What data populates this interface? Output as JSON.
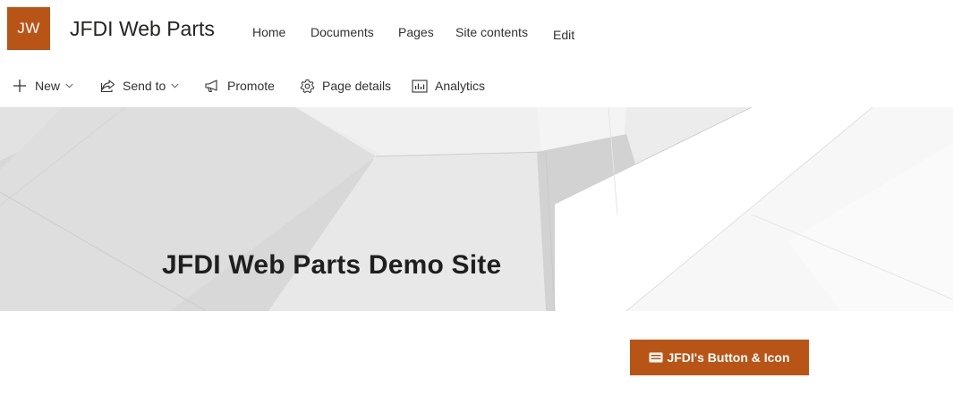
{
  "site": {
    "logo_initials": "JW",
    "title": "JFDI Web Parts",
    "brand_color": "#b85416"
  },
  "nav": {
    "items": [
      "Home",
      "Documents",
      "Pages",
      "Site contents",
      "Edit"
    ]
  },
  "command_bar": {
    "new_label": "New",
    "send_to_label": "Send to",
    "promote_label": "Promote",
    "page_details_label": "Page details",
    "analytics_label": "Analytics",
    "icons": [
      "plus-icon",
      "share-icon",
      "megaphone-icon",
      "gear-icon",
      "chart-icon"
    ]
  },
  "hero": {
    "title": "JFDI Web Parts Demo Site"
  },
  "web_parts": {
    "button_label": "JFDI's Button & Icon",
    "button_icon": "card-icon",
    "button_color": "#b85416"
  }
}
